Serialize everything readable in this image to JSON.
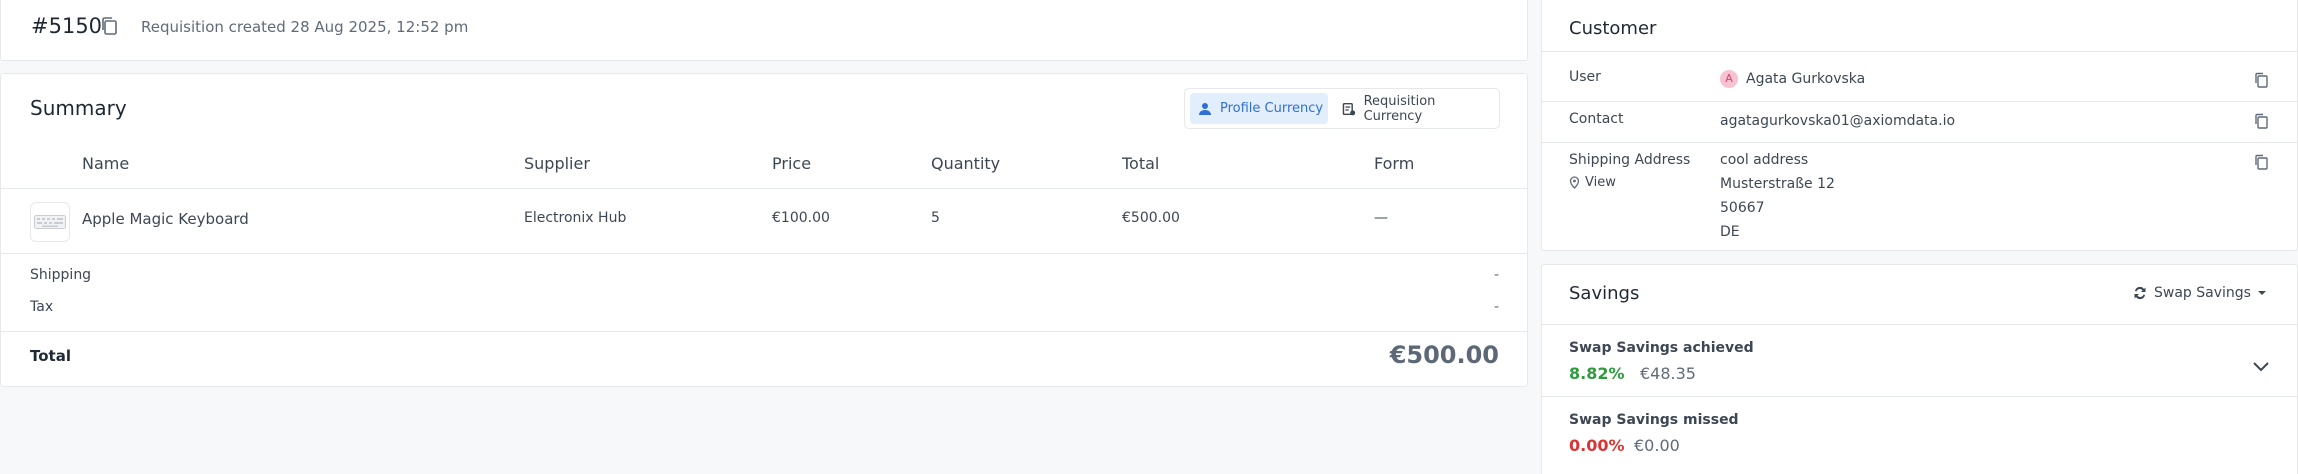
{
  "header": {
    "id": "#5150",
    "created": "Requisition created 28 Aug 2025, 12:52 pm"
  },
  "summary": {
    "title": "Summary",
    "toggle": {
      "profile": "Profile Currency",
      "requisition": "Requisition Currency",
      "active": "profile"
    },
    "columns": [
      "Name",
      "Supplier",
      "Price",
      "Quantity",
      "Total",
      "Form"
    ],
    "rows": [
      {
        "name": "Apple Magic Keyboard",
        "supplier": "Electronix Hub",
        "price": "€100.00",
        "quantity": "5",
        "total": "€500.00",
        "form": "—"
      }
    ],
    "shipping": {
      "label": "Shipping",
      "value": "-"
    },
    "tax": {
      "label": "Tax",
      "value": "-"
    },
    "total": {
      "label": "Total",
      "value": "€500.00"
    }
  },
  "customer": {
    "title": "Customer",
    "user": {
      "label": "User",
      "initial": "A",
      "value": "Agata Gurkovska"
    },
    "contact": {
      "label": "Contact",
      "value": "agatagurkovska01@axiomdata.io"
    },
    "shipping": {
      "label": "Shipping Address",
      "view": "View",
      "lines": [
        "cool address",
        "Musterstraße 12",
        "50667",
        "DE"
      ]
    }
  },
  "savings": {
    "title": "Savings",
    "swap_button": "Swap Savings",
    "achieved": {
      "label": "Swap Savings achieved",
      "pct": "8.82%",
      "amount": "€48.35"
    },
    "missed": {
      "label": "Swap Savings missed",
      "pct": "0.00%",
      "amount": "€0.00"
    },
    "colors": {
      "positive": "#2e9b3f",
      "negative": "#d93535",
      "accent": "#2f6fd6"
    }
  }
}
